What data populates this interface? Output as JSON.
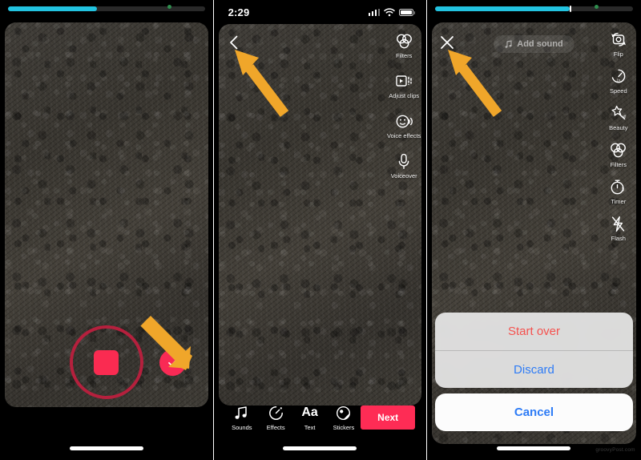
{
  "meta": {
    "watermark": "groovyPost.com"
  },
  "colors": {
    "accent_red": "#FE2C55",
    "record_red": "#FA2B51",
    "record_ring": "#B5203D",
    "progress_cyan": "#22C3E0",
    "arrow_orange": "#F0A62A",
    "sheet_destructive": "#F5524F",
    "sheet_normal": "#2E7CF6",
    "video_bg": "#3D3A34"
  },
  "panels": [
    {
      "id": "recording",
      "name": "recording-screen",
      "progress": {
        "percent": 45,
        "show_tick": false
      },
      "controls": {
        "record_button": "record-stop-button",
        "confirm_button": "confirm-checkmark-button"
      }
    },
    {
      "id": "editing",
      "name": "edit-screen",
      "status_bar": {
        "time": "2:29",
        "icons": [
          "cellular-signal-icon",
          "wifi-icon",
          "battery-icon"
        ]
      },
      "back_label": "back-chevron",
      "rail": [
        {
          "label": "Filters",
          "icon": "filters-icon"
        },
        {
          "label": "Adjust clips",
          "icon": "adjust-clips-icon"
        },
        {
          "label": "Voice effects",
          "icon": "voice-effects-icon"
        },
        {
          "label": "Voiceover",
          "icon": "voiceover-icon"
        }
      ],
      "toolbar": [
        {
          "label": "Sounds",
          "icon": "music-note-icon"
        },
        {
          "label": "Effects",
          "icon": "effects-clock-icon"
        },
        {
          "label": "Text",
          "icon": "text-aa-icon"
        },
        {
          "label": "Stickers",
          "icon": "stickers-icon"
        }
      ],
      "next_label": "Next"
    },
    {
      "id": "camera",
      "name": "camera-screen",
      "progress": {
        "percent": 68,
        "show_tick": true
      },
      "close_label": "close-x",
      "add_sound_label": "Add sound",
      "rail": [
        {
          "label": "Flip",
          "icon": "flip-camera-icon"
        },
        {
          "label": "Speed",
          "icon": "speed-icon"
        },
        {
          "label": "Beauty",
          "icon": "beauty-wand-icon"
        },
        {
          "label": "Filters",
          "icon": "filters-icon"
        },
        {
          "label": "Timer",
          "icon": "timer-icon"
        },
        {
          "label": "Flash",
          "icon": "flash-off-icon"
        }
      ],
      "action_sheet": {
        "options": [
          {
            "label": "Start over",
            "style": "destructive"
          },
          {
            "label": "Discard",
            "style": "normal"
          }
        ],
        "cancel_label": "Cancel"
      }
    }
  ]
}
